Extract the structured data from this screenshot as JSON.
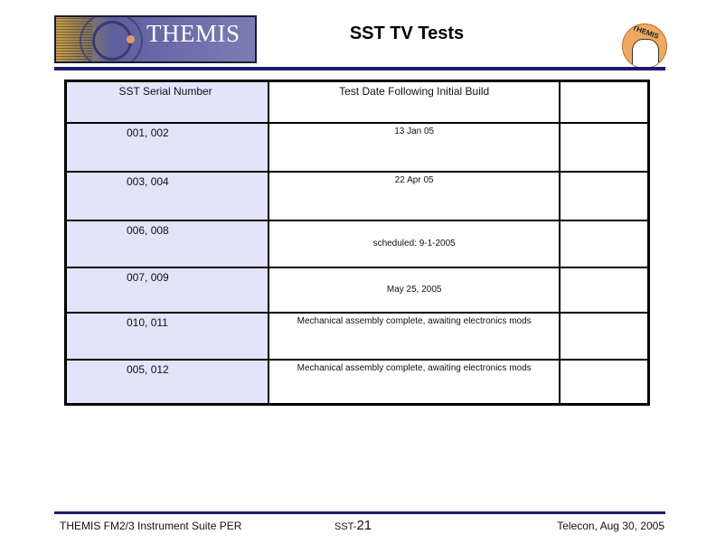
{
  "header": {
    "logo_text": "THEMIS",
    "title": "SST TV Tests",
    "badge_text": "THEMIS"
  },
  "table": {
    "headers": [
      "SST Serial Number",
      "Test Date Following Initial Build",
      ""
    ],
    "rows": [
      {
        "serial": "001, 002",
        "date": "13 Jan 05",
        "note": ""
      },
      {
        "serial": "003, 004",
        "date": "22 Apr 05",
        "note": ""
      },
      {
        "serial": "006, 008",
        "date": "scheduled: 9-1-2005",
        "note": ""
      },
      {
        "serial": "007, 009",
        "date": "May 25, 2005",
        "note": ""
      },
      {
        "serial": "010, 011",
        "date": "Mechanical assembly complete, awaiting electronics mods",
        "note": ""
      },
      {
        "serial": "005, 012",
        "date": "Mechanical assembly complete, awaiting electronics mods",
        "note": ""
      }
    ]
  },
  "footer": {
    "left": "THEMIS FM2/3 Instrument Suite PER",
    "center_prefix": "SST-",
    "center_number": "21",
    "right": "Telecon, Aug 30, 2005"
  },
  "colors": {
    "accent_rule": "#1c1c6e",
    "serial_column_bg": "#e3e3fa"
  }
}
